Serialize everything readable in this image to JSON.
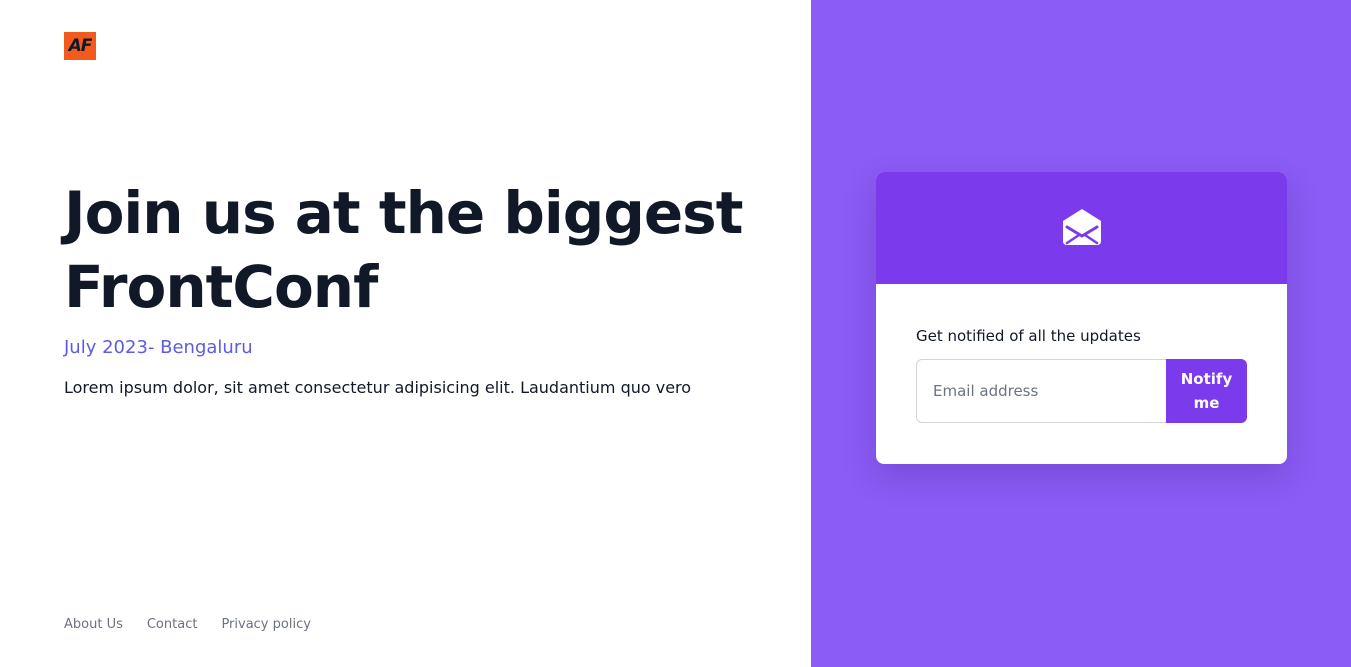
{
  "logo": {
    "text": "AF"
  },
  "hero": {
    "title": "Join us at the biggest FrontConf",
    "date": "July 2023- Bengaluru",
    "description": "Lorem ipsum dolor, sit amet consectetur adipisicing elit. Laudantium quo vero"
  },
  "footer": {
    "links": [
      "About Us",
      "Contact",
      "Privacy policy"
    ]
  },
  "signup": {
    "icon": "envelope-open-icon",
    "label": "Get notified of all the updates",
    "email_placeholder": "Email address",
    "button_label": "Notify me"
  },
  "colors": {
    "accent": "#7c3aed",
    "panel": "#8b5cf6",
    "date_text": "#5b5ce2",
    "logo_bg": "#f25a1e"
  }
}
